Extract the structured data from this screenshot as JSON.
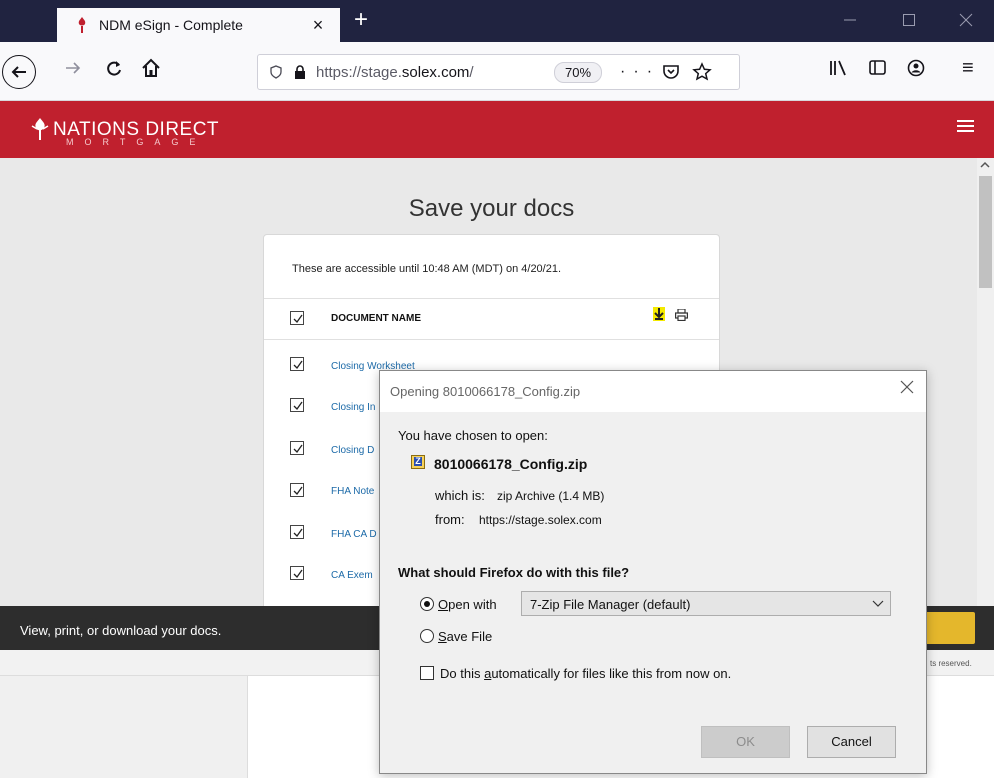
{
  "browser": {
    "tab_title": "NDM eSign - Complete",
    "tab_close": "×",
    "new_tab": "+",
    "url_prefix": "https://stage.",
    "url_domain": "solex.com",
    "url_suffix": "/",
    "zoom": "70%",
    "page_actions": "··· ",
    "menu_icon": "≡"
  },
  "site": {
    "logo": "NATIONS DIRECT",
    "logo_sub": "MORTGAGE",
    "brand_color": "#c0202e"
  },
  "page": {
    "title": "Save your docs",
    "note": "These are accessible until 10:48 AM (MDT) on 4/20/21.",
    "column_header": "DOCUMENT NAME",
    "documents": [
      "Closing Worksheet",
      "Closing In",
      "Closing D",
      "FHA Note",
      "FHA CA D",
      "CA Exem"
    ]
  },
  "banner": {
    "text": "View, print, or download your docs.",
    "footer": "ts reserved."
  },
  "dialog": {
    "title": "Opening 8010066178_Config.zip",
    "intro": "You have chosen to open:",
    "filename": "8010066178_Config.zip",
    "which_is_label": "which is:",
    "which_is_value": "zip Archive (1.4 MB)",
    "from_label": "from:",
    "from_value": "https://stage.solex.com",
    "question": "What should Firefox do with this file?",
    "open_with_key": "O",
    "open_with_rest": "pen with",
    "open_with_app": "7-Zip File Manager (default)",
    "save_file_key": "S",
    "save_file_rest": "ave File",
    "auto_pre": "Do this ",
    "auto_key": "a",
    "auto_post": "utomatically for files like this from now on.",
    "ok": "OK",
    "cancel": "Cancel"
  }
}
